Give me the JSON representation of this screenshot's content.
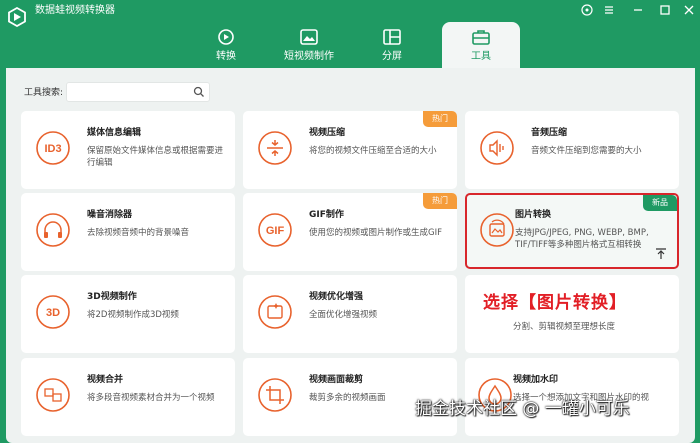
{
  "app": {
    "title": "数据蛙视频转换器",
    "window_controls": [
      "minimize",
      "maximize",
      "close"
    ]
  },
  "nav": {
    "tabs": [
      {
        "label": "转换",
        "icon": "convert-icon",
        "active": false
      },
      {
        "label": "短视频制作",
        "icon": "short-video-icon",
        "active": false
      },
      {
        "label": "分屏",
        "icon": "split-screen-icon",
        "active": false
      },
      {
        "label": "工具",
        "icon": "toolbox-icon",
        "active": true
      }
    ]
  },
  "search": {
    "label": "工具搜索:",
    "value": "",
    "placeholder": ""
  },
  "tools": [
    {
      "name": "媒体信息编辑",
      "desc": "保留原始文件媒体信息或根据需要进行编辑",
      "icon": "id3-icon",
      "badge": ""
    },
    {
      "name": "视频压缩",
      "desc": "将您的视频文件压缩至合适的大小",
      "icon": "video-compress-icon",
      "badge": "热门"
    },
    {
      "name": "音频压缩",
      "desc": "音频文件压缩到您需要的大小",
      "icon": "audio-compress-icon",
      "badge": ""
    },
    {
      "name": "噪音消除器",
      "desc": "去除视频音频中的背景噪音",
      "icon": "headphones-icon",
      "badge": ""
    },
    {
      "name": "GIF制作",
      "desc": "使用您的视频或图片制作或生成GIF",
      "icon": "gif-icon",
      "badge": "热门"
    },
    {
      "name": "图片转换",
      "desc": "支持JPG/JPEG, PNG, WEBP, BMP, TIF/TIFF等多种图片格式互相转换",
      "icon": "image-convert-icon",
      "badge": "新品",
      "selected": true
    },
    {
      "name": "3D视频制作",
      "desc": "将2D视频制作成3D视频",
      "icon": "3d-icon",
      "badge": ""
    },
    {
      "name": "视频优化增强",
      "desc": "全面优化增强视频",
      "icon": "video-enhance-icon",
      "badge": ""
    },
    {
      "name": "",
      "desc": "分割、剪辑视频至理想长度",
      "icon": "",
      "badge": ""
    },
    {
      "name": "视频合并",
      "desc": "将多段音视频素材合并为一个视频",
      "icon": "video-merge-icon",
      "badge": ""
    },
    {
      "name": "视频画面裁剪",
      "desc": "裁剪多余的视频画面",
      "icon": "video-crop-icon",
      "badge": ""
    },
    {
      "name": "视频加水印",
      "desc": "选择一个想添加文字和图片水印的视",
      "icon": "watermark-icon",
      "badge": ""
    }
  ],
  "annotation": "选择【图片转换】",
  "watermark": "掘金技术社区 @ 一罐小可乐",
  "colors": {
    "brand_green": "#1f9a63",
    "hot_orange": "#f59c3a",
    "accent_red": "#e21f26",
    "icon_orange": "#e8622d"
  }
}
